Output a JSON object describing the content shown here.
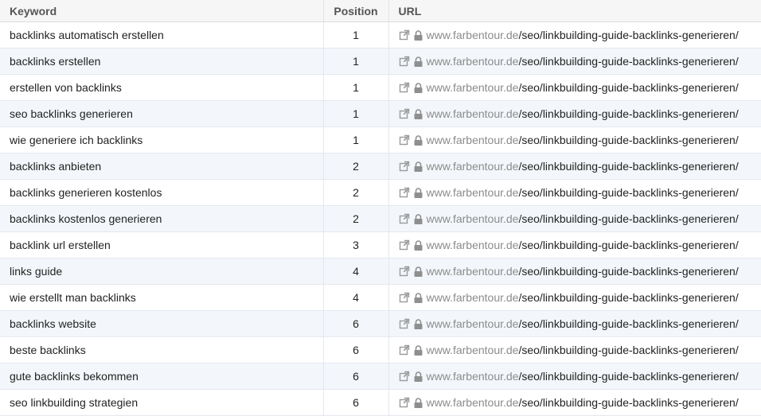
{
  "headers": {
    "keyword": "Keyword",
    "position": "Position",
    "url": "URL"
  },
  "rows": [
    {
      "keyword": "backlinks automatisch erstellen",
      "position": "1",
      "domain": "www.farbentour.de",
      "path": "/seo/linkbuilding-guide-backlinks-generieren/"
    },
    {
      "keyword": "backlinks erstellen",
      "position": "1",
      "domain": "www.farbentour.de",
      "path": "/seo/linkbuilding-guide-backlinks-generieren/"
    },
    {
      "keyword": "erstellen von backlinks",
      "position": "1",
      "domain": "www.farbentour.de",
      "path": "/seo/linkbuilding-guide-backlinks-generieren/"
    },
    {
      "keyword": "seo backlinks generieren",
      "position": "1",
      "domain": "www.farbentour.de",
      "path": "/seo/linkbuilding-guide-backlinks-generieren/"
    },
    {
      "keyword": "wie generiere ich backlinks",
      "position": "1",
      "domain": "www.farbentour.de",
      "path": "/seo/linkbuilding-guide-backlinks-generieren/"
    },
    {
      "keyword": "backlinks anbieten",
      "position": "2",
      "domain": "www.farbentour.de",
      "path": "/seo/linkbuilding-guide-backlinks-generieren/"
    },
    {
      "keyword": "backlinks generieren kostenlos",
      "position": "2",
      "domain": "www.farbentour.de",
      "path": "/seo/linkbuilding-guide-backlinks-generieren/"
    },
    {
      "keyword": "backlinks kostenlos generieren",
      "position": "2",
      "domain": "www.farbentour.de",
      "path": "/seo/linkbuilding-guide-backlinks-generieren/"
    },
    {
      "keyword": "backlink url erstellen",
      "position": "3",
      "domain": "www.farbentour.de",
      "path": "/seo/linkbuilding-guide-backlinks-generieren/"
    },
    {
      "keyword": "links guide",
      "position": "4",
      "domain": "www.farbentour.de",
      "path": "/seo/linkbuilding-guide-backlinks-generieren/"
    },
    {
      "keyword": "wie erstellt man backlinks",
      "position": "4",
      "domain": "www.farbentour.de",
      "path": "/seo/linkbuilding-guide-backlinks-generieren/"
    },
    {
      "keyword": "backlinks website",
      "position": "6",
      "domain": "www.farbentour.de",
      "path": "/seo/linkbuilding-guide-backlinks-generieren/"
    },
    {
      "keyword": "beste backlinks",
      "position": "6",
      "domain": "www.farbentour.de",
      "path": "/seo/linkbuilding-guide-backlinks-generieren/"
    },
    {
      "keyword": "gute backlinks bekommen",
      "position": "6",
      "domain": "www.farbentour.de",
      "path": "/seo/linkbuilding-guide-backlinks-generieren/"
    },
    {
      "keyword": "seo linkbuilding strategien",
      "position": "6",
      "domain": "www.farbentour.de",
      "path": "/seo/linkbuilding-guide-backlinks-generieren/"
    }
  ],
  "icons": {
    "external": "external-link-icon",
    "secure": "lock-icon"
  },
  "colors": {
    "domain": "#8b8b8b",
    "row_alt": "#f3f7fb",
    "header_bg": "#f6f6f6"
  }
}
